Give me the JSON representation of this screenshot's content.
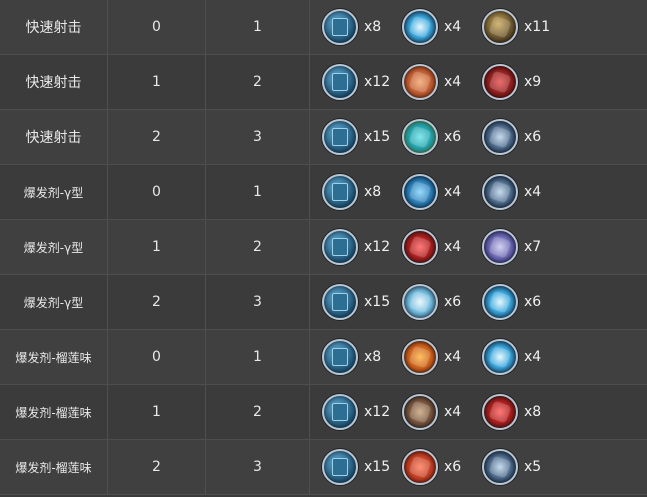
{
  "rows": [
    {
      "name": "快速射击",
      "from": "0",
      "to": "1",
      "mats": [
        {
          "icon": "blue-book-icon",
          "qty": "x8"
        },
        {
          "icon": "blue-butterfly-crystal-icon",
          "qty": "x4"
        },
        {
          "icon": "bronze-mechanism-icon",
          "qty": "x11"
        }
      ]
    },
    {
      "name": "快速射击",
      "from": "1",
      "to": "2",
      "mats": [
        {
          "icon": "blue-book-icon",
          "qty": "x12"
        },
        {
          "icon": "orange-plate-icon",
          "qty": "x4"
        },
        {
          "icon": "red-cube-icon",
          "qty": "x9"
        }
      ]
    },
    {
      "name": "快速射击",
      "from": "2",
      "to": "3",
      "mats": [
        {
          "icon": "blue-book-icon",
          "qty": "x15"
        },
        {
          "icon": "teal-box-icon",
          "qty": "x6"
        },
        {
          "icon": "gear-cluster-icon",
          "qty": "x6"
        }
      ]
    },
    {
      "name": "爆发剂-γ型",
      "from": "0",
      "to": "1",
      "mats": [
        {
          "icon": "blue-book-icon",
          "qty": "x8"
        },
        {
          "icon": "blue-crystal-icon",
          "qty": "x4"
        },
        {
          "icon": "gear-cluster-icon",
          "qty": "x4"
        }
      ]
    },
    {
      "name": "爆发剂-γ型",
      "from": "1",
      "to": "2",
      "mats": [
        {
          "icon": "blue-book-icon",
          "qty": "x12"
        },
        {
          "icon": "red-gem-icon",
          "qty": "x4"
        },
        {
          "icon": "purple-cube-icon",
          "qty": "x7"
        }
      ]
    },
    {
      "name": "爆发剂-γ型",
      "from": "2",
      "to": "3",
      "mats": [
        {
          "icon": "blue-book-icon",
          "qty": "x15"
        },
        {
          "icon": "crystal-shard-icon",
          "qty": "x6"
        },
        {
          "icon": "blue-butterfly-crystal-icon",
          "qty": "x6"
        }
      ]
    },
    {
      "name": "爆发剂-榴莲味",
      "from": "0",
      "to": "1",
      "mats": [
        {
          "icon": "blue-book-icon",
          "qty": "x8"
        },
        {
          "icon": "fire-box-icon",
          "qty": "x4"
        },
        {
          "icon": "blue-butterfly-crystal-icon",
          "qty": "x4"
        }
      ]
    },
    {
      "name": "爆发剂-榴莲味",
      "from": "1",
      "to": "2",
      "mats": [
        {
          "icon": "blue-book-icon",
          "qty": "x12"
        },
        {
          "icon": "bronze-gear-icon",
          "qty": "x4"
        },
        {
          "icon": "red-gem-icon",
          "qty": "x8"
        }
      ]
    },
    {
      "name": "爆发剂-榴莲味",
      "from": "2",
      "to": "3",
      "mats": [
        {
          "icon": "blue-book-icon",
          "qty": "x15"
        },
        {
          "icon": "red-box-icon",
          "qty": "x6"
        },
        {
          "icon": "gear-cluster-icon",
          "qty": "x5"
        }
      ]
    }
  ]
}
